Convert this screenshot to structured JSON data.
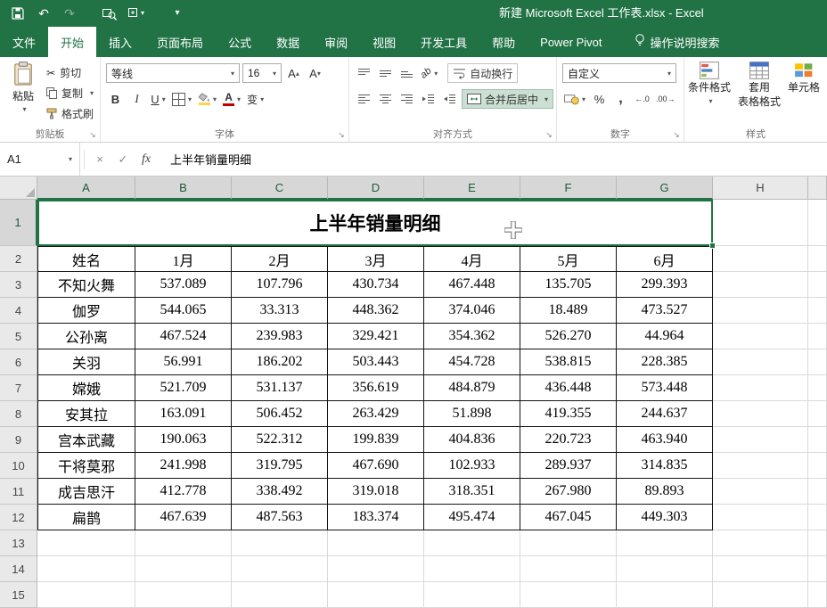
{
  "colors": {
    "accent": "#217346"
  },
  "title_bar": {
    "title": "新建 Microsoft Excel 工作表.xlsx - Excel"
  },
  "ribbon_tabs": [
    {
      "label": "文件",
      "active": false
    },
    {
      "label": "开始",
      "active": true
    },
    {
      "label": "插入",
      "active": false
    },
    {
      "label": "页面布局",
      "active": false
    },
    {
      "label": "公式",
      "active": false
    },
    {
      "label": "数据",
      "active": false
    },
    {
      "label": "审阅",
      "active": false
    },
    {
      "label": "视图",
      "active": false
    },
    {
      "label": "开发工具",
      "active": false
    },
    {
      "label": "帮助",
      "active": false
    },
    {
      "label": "Power Pivot",
      "active": false
    }
  ],
  "tell_me": {
    "label": "操作说明搜索"
  },
  "ribbon": {
    "clipboard": {
      "group": "剪贴板",
      "paste": "粘贴",
      "cut": "剪切",
      "copy": "复制",
      "format_painter": "格式刷"
    },
    "font": {
      "group": "字体",
      "font_name": "等线",
      "font_size": "16"
    },
    "alignment": {
      "group": "对齐方式",
      "wrap_text": "自动换行",
      "merge_center": "合并后居中"
    },
    "number": {
      "group": "数字",
      "format": "自定义"
    },
    "styles": {
      "group": "样式",
      "conditional": "条件格式",
      "format_table_line1": "套用",
      "format_table_line2": "表格格式",
      "cell_styles": "单元格"
    }
  },
  "icons": {
    "dropdown": "▾",
    "up": "▴",
    "undo": "↶",
    "redo": "↷",
    "bold": "B",
    "italic": "I",
    "underline": "U",
    "scissors": "✂",
    "percent": "%",
    "comma": ",",
    "phonetic": "变",
    "letterA": "A",
    "fx": "fx",
    "cancel": "×",
    "enter": "✓",
    "launcher": "↘",
    "increase_decimal": "←.0",
    "decrease_decimal": ".00→",
    "orientation": "ab"
  },
  "formula_bar": {
    "name_box": "A1",
    "formula": "上半年销量明细"
  },
  "sheet": {
    "columns": [
      "A",
      "B",
      "C",
      "D",
      "E",
      "F",
      "G",
      "H"
    ],
    "row_count": 15,
    "selection": {
      "active_cell": "A1",
      "range": "A1:G1"
    },
    "title": "上半年销量明细",
    "header": [
      "姓名",
      "1月",
      "2月",
      "3月",
      "4月",
      "5月",
      "6月"
    ],
    "data": [
      [
        "不知火舞",
        "537.089",
        "107.796",
        "430.734",
        "467.448",
        "135.705",
        "299.393"
      ],
      [
        "伽罗",
        "544.065",
        "33.313",
        "448.362",
        "374.046",
        "18.489",
        "473.527"
      ],
      [
        "公孙离",
        "467.524",
        "239.983",
        "329.421",
        "354.362",
        "526.270",
        "44.964"
      ],
      [
        "关羽",
        "56.991",
        "186.202",
        "503.443",
        "454.728",
        "538.815",
        "228.385"
      ],
      [
        "嫦娥",
        "521.709",
        "531.137",
        "356.619",
        "484.879",
        "436.448",
        "573.448"
      ],
      [
        "安其拉",
        "163.091",
        "506.452",
        "263.429",
        "51.898",
        "419.355",
        "244.637"
      ],
      [
        "宫本武藏",
        "190.063",
        "522.312",
        "199.839",
        "404.836",
        "220.723",
        "463.940"
      ],
      [
        "干将莫邪",
        "241.998",
        "319.795",
        "467.690",
        "102.933",
        "289.937",
        "314.835"
      ],
      [
        "成吉思汗",
        "412.778",
        "338.492",
        "319.018",
        "318.351",
        "267.980",
        "89.893"
      ],
      [
        "扁鹊",
        "467.639",
        "487.563",
        "183.374",
        "495.474",
        "467.045",
        "449.303"
      ]
    ]
  }
}
